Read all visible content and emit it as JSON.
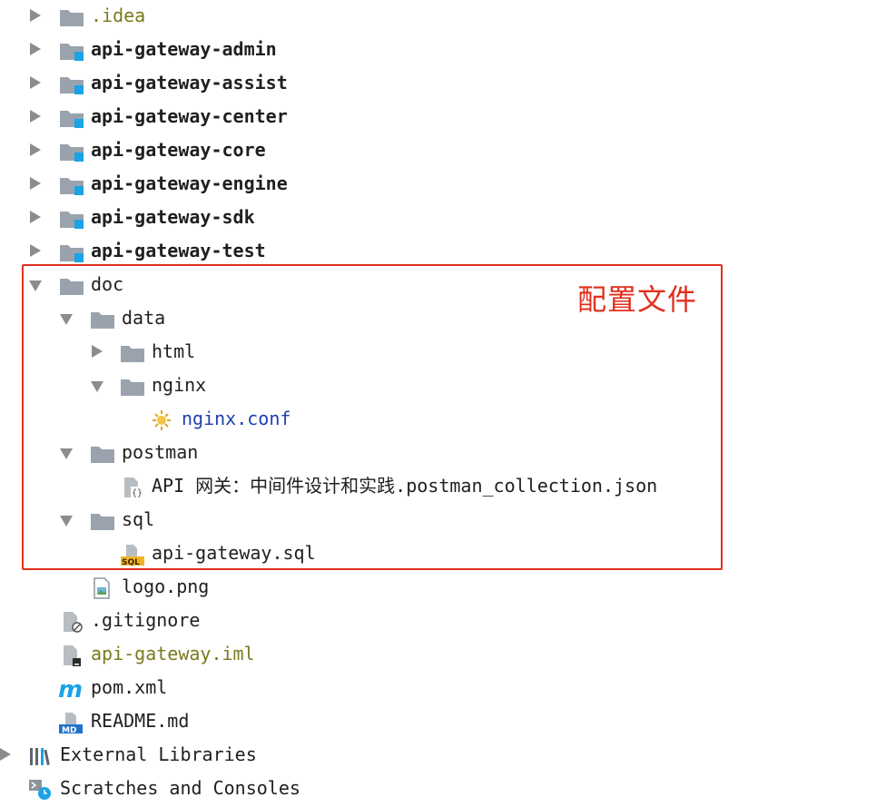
{
  "tree": {
    "items": [
      {
        "label": ".idea",
        "kind": "folder",
        "color": "#7a7a1e"
      },
      {
        "label": "api-gateway-admin",
        "kind": "module"
      },
      {
        "label": "api-gateway-assist",
        "kind": "module"
      },
      {
        "label": "api-gateway-center",
        "kind": "module"
      },
      {
        "label": "api-gateway-core",
        "kind": "module"
      },
      {
        "label": "api-gateway-engine",
        "kind": "module"
      },
      {
        "label": "api-gateway-sdk",
        "kind": "module"
      },
      {
        "label": "api-gateway-test",
        "kind": "module"
      },
      {
        "label": "doc",
        "kind": "folder"
      },
      {
        "label": "data",
        "kind": "folder"
      },
      {
        "label": "html",
        "kind": "folder"
      },
      {
        "label": "nginx",
        "kind": "folder"
      },
      {
        "label": "nginx.conf",
        "kind": "nginx-config",
        "color": "#1f3fb0"
      },
      {
        "label": "postman",
        "kind": "folder"
      },
      {
        "label": "API 网关：中间件设计和实践.postman_collection.json",
        "kind": "json-file"
      },
      {
        "label": "sql",
        "kind": "folder"
      },
      {
        "label": "api-gateway.sql",
        "kind": "sql-file",
        "icon_text": "SQL"
      },
      {
        "label": "logo.png",
        "kind": "image-file"
      },
      {
        "label": ".gitignore",
        "kind": "ignore-file"
      },
      {
        "label": "api-gateway.iml",
        "kind": "iml-file",
        "color": "#7a7a1e"
      },
      {
        "label": "pom.xml",
        "kind": "maven-file",
        "icon_text": "m"
      },
      {
        "label": "README.md",
        "kind": "markdown-file",
        "icon_text": "MD"
      },
      {
        "label": "External Libraries",
        "kind": "libraries"
      },
      {
        "label": "Scratches and Consoles",
        "kind": "scratches"
      }
    ]
  },
  "annotation": {
    "label": "配置文件",
    "color": "#e0301e"
  },
  "colors": {
    "folder": "#9aa3ad",
    "module_badge": "#1aa3e6",
    "arrow": "#8c8c8c"
  }
}
